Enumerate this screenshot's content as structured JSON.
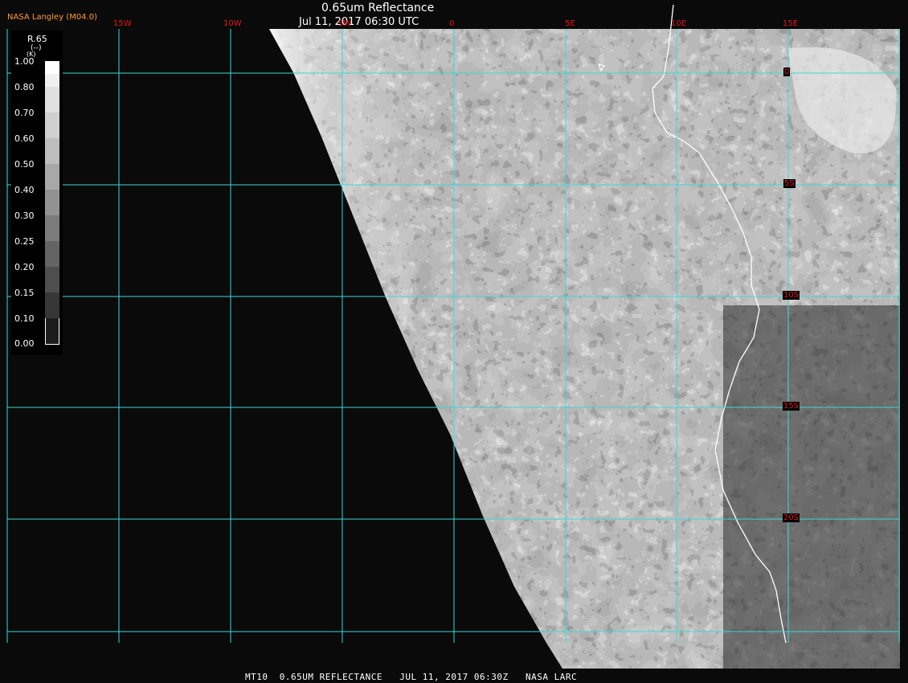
{
  "header": {
    "credit": "NASA Langley (M04.0)",
    "title": "0.65um Reflectance",
    "timestamp": "Jul 11, 2017 06:30 UTC"
  },
  "longitude_labels": [
    "15W",
    "10W",
    "5W",
    "0",
    "5E",
    "10E",
    "15E"
  ],
  "latitude_labels": [
    "0",
    "5S",
    "10S",
    "15S",
    "20S"
  ],
  "legend": {
    "title": "R.65",
    "units": "(--)",
    "k": "(K)",
    "labels": [
      "1.00",
      "0.80",
      "0.70",
      "0.60",
      "0.50",
      "0.40",
      "0.30",
      "0.25",
      "0.20",
      "0.15",
      "0.10",
      "0.00"
    ]
  },
  "footer": {
    "text": "MT10  0.65UM REFLECTANCE   JUL 11, 2017 06:30Z   NASA LARC"
  },
  "colors": {
    "grid": "#3fd6d6",
    "label_red": "#e01818",
    "credit_orange": "#ff9a3c",
    "coastline": "#ffffff"
  }
}
